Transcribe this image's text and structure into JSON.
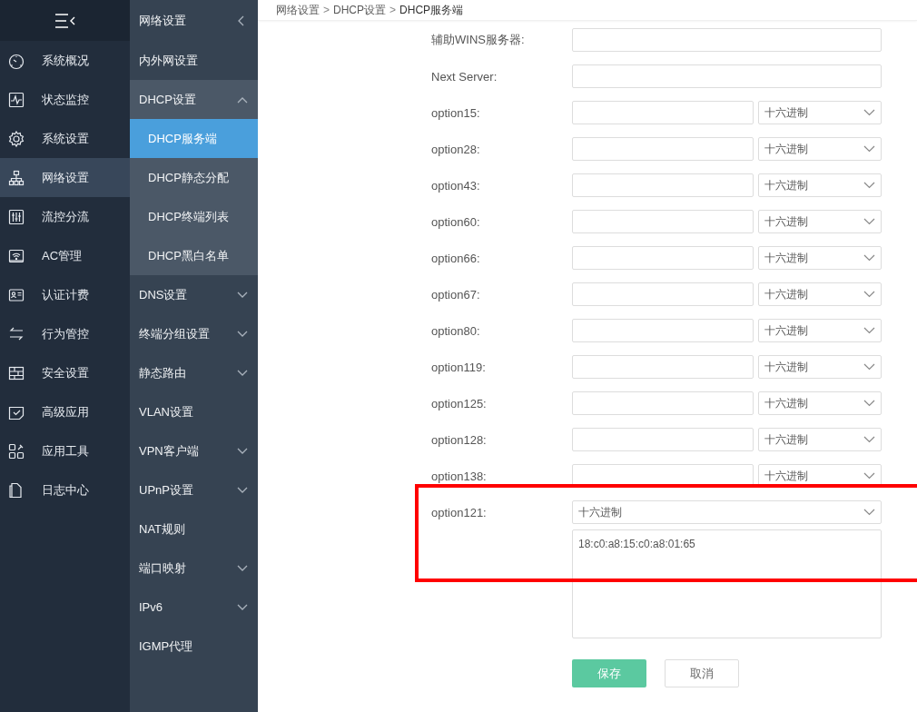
{
  "main_nav": {
    "items": [
      {
        "label": "系统概况",
        "selected": false
      },
      {
        "label": "状态监控",
        "selected": false
      },
      {
        "label": "系统设置",
        "selected": false
      },
      {
        "label": "网络设置",
        "selected": true
      },
      {
        "label": "流控分流",
        "selected": false
      },
      {
        "label": "AC管理",
        "selected": false
      },
      {
        "label": "认证计费",
        "selected": false
      },
      {
        "label": "行为管控",
        "selected": false
      },
      {
        "label": "安全设置",
        "selected": false
      },
      {
        "label": "高级应用",
        "selected": false
      },
      {
        "label": "应用工具",
        "selected": false
      },
      {
        "label": "日志中心",
        "selected": false
      }
    ]
  },
  "sub_nav": {
    "title": "网络设置",
    "items": [
      {
        "label": "内外网设置",
        "kind": "link",
        "selected": false
      },
      {
        "label": "DHCP设置",
        "kind": "group",
        "expanded": true,
        "children": [
          {
            "label": "DHCP服务端",
            "selected": true
          },
          {
            "label": "DHCP静态分配",
            "selected": false
          },
          {
            "label": "DHCP终端列表",
            "selected": false
          },
          {
            "label": "DHCP黑白名单",
            "selected": false
          }
        ]
      },
      {
        "label": "DNS设置",
        "kind": "group",
        "expanded": false
      },
      {
        "label": "终端分组设置",
        "kind": "group",
        "expanded": false
      },
      {
        "label": "静态路由",
        "kind": "group",
        "expanded": false
      },
      {
        "label": "VLAN设置",
        "kind": "link",
        "selected": false
      },
      {
        "label": "VPN客户端",
        "kind": "group",
        "expanded": false
      },
      {
        "label": "UPnP设置",
        "kind": "group",
        "expanded": false
      },
      {
        "label": "NAT规则",
        "kind": "link",
        "selected": false
      },
      {
        "label": "端口映射",
        "kind": "group",
        "expanded": false
      },
      {
        "label": "IPv6",
        "kind": "group",
        "expanded": false
      },
      {
        "label": "IGMP代理",
        "kind": "link",
        "selected": false
      }
    ]
  },
  "breadcrumb": [
    {
      "kind": "link",
      "text": "网络设置"
    },
    {
      "kind": "separator",
      "text": ">"
    },
    {
      "kind": "link",
      "text": "DHCP设置"
    },
    {
      "kind": "separator",
      "text": ">"
    },
    {
      "kind": "current",
      "text": "DHCP服务端"
    }
  ],
  "form": {
    "rows": [
      {
        "kind": "text",
        "label": "辅助WINS服务器:",
        "highlighted": false
      },
      {
        "kind": "text",
        "label": "Next Server:",
        "highlighted": false
      },
      {
        "kind": "option",
        "label": "option15:",
        "format": "十六进制",
        "highlighted": false
      },
      {
        "kind": "option",
        "label": "option28:",
        "format": "十六进制",
        "highlighted": false
      },
      {
        "kind": "option",
        "label": "option43:",
        "format": "十六进制",
        "highlighted": false
      },
      {
        "kind": "option",
        "label": "option60:",
        "format": "十六进制",
        "highlighted": false
      },
      {
        "kind": "option",
        "label": "option66:",
        "format": "十六进制",
        "highlighted": false
      },
      {
        "kind": "option",
        "label": "option67:",
        "format": "十六进制",
        "highlighted": false
      },
      {
        "kind": "option",
        "label": "option80:",
        "format": "十六进制",
        "highlighted": false
      },
      {
        "kind": "option",
        "label": "option119:",
        "format": "十六进制",
        "highlighted": false
      },
      {
        "kind": "option",
        "label": "option125:",
        "format": "十六进制",
        "highlighted": false
      },
      {
        "kind": "option",
        "label": "option128:",
        "format": "十六进制",
        "highlighted": false
      },
      {
        "kind": "option",
        "label": "option138:",
        "format": "十六进制",
        "highlighted": false
      },
      {
        "kind": "textarea",
        "label": "option121:",
        "format": "十六进制",
        "value": "18:c0:a8:15:c0:a8:01:65",
        "highlighted": true
      }
    ],
    "buttons": [
      {
        "label": "保存",
        "kind": "primary"
      },
      {
        "label": "取消",
        "kind": "secondary"
      }
    ]
  }
}
